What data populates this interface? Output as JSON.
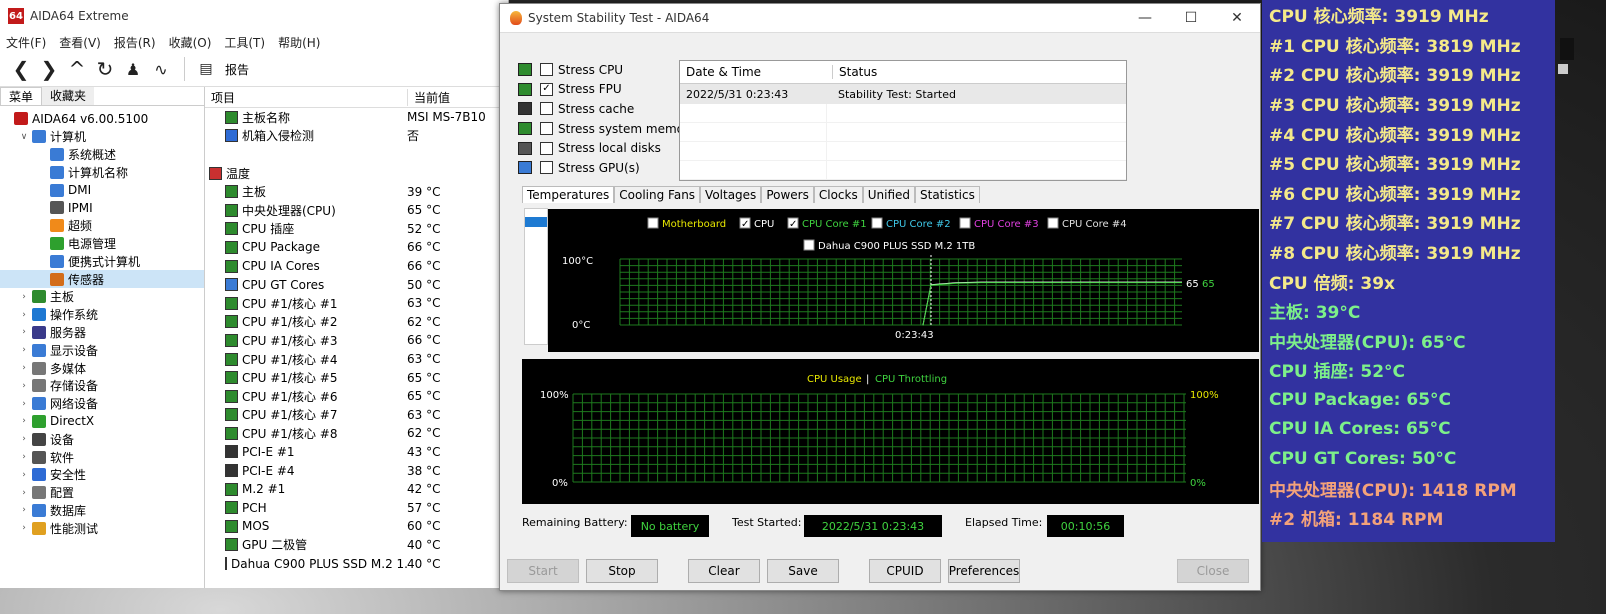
{
  "main_window": {
    "title": "AIDA64 Extreme",
    "logo": "64",
    "menu": [
      "文件(F)",
      "查看(V)",
      "报告(R)",
      "收藏(O)",
      "工具(T)",
      "帮助(H)"
    ],
    "toolbar_report": "报告",
    "tabs": {
      "menu": "菜单",
      "favorites": "收藏夹"
    },
    "tree": [
      {
        "label": "AIDA64 v6.00.5100",
        "level": 0,
        "icon": "aida-logo-icon",
        "color": "#c21a1a"
      },
      {
        "label": "计算机",
        "level": 1,
        "expanded": true,
        "icon": "computer-icon",
        "color": "#3a7bd5"
      },
      {
        "label": "系统概述",
        "level": 2,
        "icon": "summary-icon",
        "color": "#3a7bd5"
      },
      {
        "label": "计算机名称",
        "level": 2,
        "icon": "computer-name-icon",
        "color": "#3a7bd5"
      },
      {
        "label": "DMI",
        "level": 2,
        "icon": "dmi-icon",
        "color": "#3a7bd5"
      },
      {
        "label": "IPMI",
        "level": 2,
        "icon": "ipmi-icon",
        "color": "#555555"
      },
      {
        "label": "超频",
        "level": 2,
        "icon": "flame-icon",
        "color": "#f08a1a"
      },
      {
        "label": "电源管理",
        "level": 2,
        "icon": "power-icon",
        "color": "#2ea02e"
      },
      {
        "label": "便携式计算机",
        "level": 2,
        "icon": "laptop-icon",
        "color": "#3a7bd5"
      },
      {
        "label": "传感器",
        "level": 2,
        "icon": "sensor-icon",
        "color": "#d36d1a",
        "selected": true
      },
      {
        "label": "主板",
        "level": 1,
        "icon": "motherboard-icon",
        "color": "#2e8b2e"
      },
      {
        "label": "操作系统",
        "level": 1,
        "icon": "windows-icon",
        "color": "#1e78d2"
      },
      {
        "label": "服务器",
        "level": 1,
        "icon": "server-icon",
        "color": "#3a3a8a"
      },
      {
        "label": "显示设备",
        "level": 1,
        "icon": "display-icon",
        "color": "#3a7bd5"
      },
      {
        "label": "多媒体",
        "level": 1,
        "icon": "speaker-icon",
        "color": "#777777"
      },
      {
        "label": "存储设备",
        "level": 1,
        "icon": "storage-icon",
        "color": "#777777"
      },
      {
        "label": "网络设备",
        "level": 1,
        "icon": "network-icon",
        "color": "#3a7bd5"
      },
      {
        "label": "DirectX",
        "level": 1,
        "icon": "directx-icon",
        "color": "#2ea02e"
      },
      {
        "label": "设备",
        "level": 1,
        "icon": "device-icon",
        "color": "#444444"
      },
      {
        "label": "软件",
        "level": 1,
        "icon": "software-icon",
        "color": "#555555"
      },
      {
        "label": "安全性",
        "level": 1,
        "icon": "shield-icon",
        "color": "#2e6bd5"
      },
      {
        "label": "配置",
        "level": 1,
        "icon": "config-icon",
        "color": "#777777"
      },
      {
        "label": "数据库",
        "level": 1,
        "icon": "database-icon",
        "color": "#3a7bd5"
      },
      {
        "label": "性能测试",
        "level": 1,
        "icon": "benchmark-icon",
        "color": "#e0a020"
      }
    ],
    "columns": {
      "item": "项目",
      "value": "当前值"
    },
    "rows": [
      {
        "name": "主板名称",
        "value": "MSI MS-7B10",
        "icon": "motherboard-icon",
        "color": "#2e8b2e",
        "indent": 1
      },
      {
        "name": "机箱入侵检测",
        "value": "否",
        "icon": "shield-icon",
        "color": "#2e6bd5",
        "indent": 1
      },
      {
        "name": "",
        "value": "",
        "spacer": true
      },
      {
        "name": "温度",
        "value": "",
        "icon": "thermometer-icon",
        "color": "#c83030",
        "indent": 0
      },
      {
        "name": "主板",
        "value": "39 °C",
        "icon": "motherboard-icon",
        "color": "#2e8b2e",
        "indent": 1
      },
      {
        "name": "中央处理器(CPU)",
        "value": "65 °C",
        "icon": "cpu-icon",
        "color": "#2e8b2e",
        "indent": 1
      },
      {
        "name": "CPU 插座",
        "value": "52 °C",
        "icon": "cpu-icon",
        "color": "#2e8b2e",
        "indent": 1
      },
      {
        "name": "CPU Package",
        "value": "66 °C",
        "icon": "cpu-icon",
        "color": "#2e8b2e",
        "indent": 1
      },
      {
        "name": "CPU IA Cores",
        "value": "66 °C",
        "icon": "cpu-icon",
        "color": "#2e8b2e",
        "indent": 1
      },
      {
        "name": "CPU GT Cores",
        "value": "50 °C",
        "icon": "gpu-icon",
        "color": "#3a7bd5",
        "indent": 1
      },
      {
        "name": "CPU #1/核心 #1",
        "value": "63 °C",
        "icon": "cpu-icon",
        "color": "#2e8b2e",
        "indent": 1
      },
      {
        "name": "CPU #1/核心 #2",
        "value": "62 °C",
        "icon": "cpu-icon",
        "color": "#2e8b2e",
        "indent": 1
      },
      {
        "name": "CPU #1/核心 #3",
        "value": "66 °C",
        "icon": "cpu-icon",
        "color": "#2e8b2e",
        "indent": 1
      },
      {
        "name": "CPU #1/核心 #4",
        "value": "63 °C",
        "icon": "cpu-icon",
        "color": "#2e8b2e",
        "indent": 1
      },
      {
        "name": "CPU #1/核心 #5",
        "value": "65 °C",
        "icon": "cpu-icon",
        "color": "#2e8b2e",
        "indent": 1
      },
      {
        "name": "CPU #1/核心 #6",
        "value": "65 °C",
        "icon": "cpu-icon",
        "color": "#2e8b2e",
        "indent": 1
      },
      {
        "name": "CPU #1/核心 #7",
        "value": "63 °C",
        "icon": "cpu-icon",
        "color": "#2e8b2e",
        "indent": 1
      },
      {
        "name": "CPU #1/核心 #8",
        "value": "62 °C",
        "icon": "cpu-icon",
        "color": "#2e8b2e",
        "indent": 1
      },
      {
        "name": "PCI-E #1",
        "value": "43 °C",
        "icon": "pcie-icon",
        "color": "#333333",
        "indent": 1
      },
      {
        "name": "PCI-E #4",
        "value": "38 °C",
        "icon": "pcie-icon",
        "color": "#333333",
        "indent": 1
      },
      {
        "name": "M.2 #1",
        "value": "42 °C",
        "icon": "m2-icon",
        "color": "#2e8b2e",
        "indent": 1
      },
      {
        "name": "PCH",
        "value": "57 °C",
        "icon": "chip-icon",
        "color": "#2e8b2e",
        "indent": 1
      },
      {
        "name": "MOS",
        "value": "60 °C",
        "icon": "mos-icon",
        "color": "#2e8b2e",
        "indent": 1
      },
      {
        "name": "GPU 二极管",
        "value": "40 °C",
        "icon": "gpu-icon",
        "color": "#2e8b2e",
        "indent": 1
      },
      {
        "name": "Dahua C900 PLUS SSD M.2 1...",
        "value": "40 °C",
        "icon": "ssd-icon",
        "color": "#555555",
        "indent": 1
      }
    ]
  },
  "stability_window": {
    "title": "System Stability Test - AIDA64",
    "stress_options": [
      {
        "label": "Stress CPU",
        "checked": false,
        "icon": "cpu-icon"
      },
      {
        "label": "Stress FPU",
        "checked": true,
        "icon": "fpu-icon"
      },
      {
        "label": "Stress cache",
        "checked": false,
        "icon": "cache-icon"
      },
      {
        "label": "Stress system memory",
        "checked": false,
        "icon": "memory-icon"
      },
      {
        "label": "Stress local disks",
        "checked": false,
        "icon": "disk-icon"
      },
      {
        "label": "Stress GPU(s)",
        "checked": false,
        "icon": "gpu-icon"
      }
    ],
    "log_columns": {
      "date": "Date & Time",
      "status": "Status"
    },
    "log_rows": [
      {
        "date": "2022/5/31 0:23:43",
        "status": "Stability Test: Started"
      }
    ],
    "tabs": [
      "Temperatures",
      "Cooling Fans",
      "Voltages",
      "Powers",
      "Clocks",
      "Unified",
      "Statistics"
    ],
    "active_tab": "Temperatures",
    "temp_legend": [
      {
        "label": "Motherboard",
        "checked": false,
        "color": "#e8e800"
      },
      {
        "label": "CPU",
        "checked": true,
        "color": "#ffffff"
      },
      {
        "label": "CPU Core #1",
        "checked": true,
        "color": "#3fd33f"
      },
      {
        "label": "CPU Core #2",
        "checked": false,
        "color": "#3fc8e8"
      },
      {
        "label": "CPU Core #3",
        "checked": false,
        "color": "#e040e0"
      },
      {
        "label": "CPU Core #4",
        "checked": false,
        "color": "#e0e0e0"
      }
    ],
    "temp_legend_2": {
      "label": "Dahua C900 PLUS SSD M.2 1TB",
      "checked": false,
      "color": "#ffffff"
    },
    "temp_axis": {
      "top": "100°C",
      "bottom": "0°C",
      "time": "0:23:43",
      "value_white": "65",
      "value_green": "65"
    },
    "usage_legend": {
      "usage": "CPU Usage",
      "sep": "|",
      "throttling": "CPU Throttling",
      "usage_color": "#e8e800",
      "throttling_color": "#3fd33f"
    },
    "usage_axis": {
      "top_left": "100%",
      "bottom_left": "0%",
      "top_right": "100%",
      "bottom_right": "0%"
    },
    "remaining_battery_label": "Remaining Battery:",
    "remaining_battery_value": "No battery",
    "test_started_label": "Test Started:",
    "test_started_value": "2022/5/31 0:23:43",
    "elapsed_label": "Elapsed Time:",
    "elapsed_value": "00:10:56",
    "buttons": {
      "start": "Start",
      "stop": "Stop",
      "clear": "Clear",
      "save": "Save",
      "cpuid": "CPUID",
      "preferences": "Preferences",
      "close": "Close"
    },
    "chart_data": {
      "type": "line",
      "series": [
        {
          "x": [
            "0:23:43",
            "end"
          ],
          "values": [
            0,
            61,
            64,
            65,
            65,
            65,
            65,
            65,
            65,
            65,
            65,
            65
          ]
        }
      ],
      "ylim": [
        0,
        100
      ]
    }
  },
  "osd": {
    "lines": [
      {
        "text": "CPU 核心频率: 3919 MHz",
        "color": "#f4e98a"
      },
      {
        "text": "#1 CPU 核心频率: 3819 MHz",
        "color": "#f4e98a"
      },
      {
        "text": "#2 CPU 核心频率: 3919 MHz",
        "color": "#f4e98a"
      },
      {
        "text": "#3 CPU 核心频率: 3919 MHz",
        "color": "#f4e98a"
      },
      {
        "text": "#4 CPU 核心频率: 3919 MHz",
        "color": "#f4e98a"
      },
      {
        "text": "#5 CPU 核心频率: 3919 MHz",
        "color": "#f4e98a"
      },
      {
        "text": "#6 CPU 核心频率: 3919 MHz",
        "color": "#f4e98a"
      },
      {
        "text": "#7 CPU 核心频率: 3919 MHz",
        "color": "#f4e98a"
      },
      {
        "text": "#8 CPU 核心频率: 3919 MHz",
        "color": "#f4e98a"
      },
      {
        "text": "CPU 倍频: 39x",
        "color": "#f4e98a"
      },
      {
        "text": "主板: 39°C",
        "color": "#7df08a"
      },
      {
        "text": "中央处理器(CPU): 65°C",
        "color": "#7df08a"
      },
      {
        "text": "CPU 插座: 52°C",
        "color": "#7df08a"
      },
      {
        "text": "CPU Package: 65°C",
        "color": "#7df08a"
      },
      {
        "text": "CPU IA Cores: 65°C",
        "color": "#7df08a"
      },
      {
        "text": "CPU GT Cores: 50°C",
        "color": "#7df08a"
      },
      {
        "text": "中央处理器(CPU): 1418 RPM",
        "color": "#f4a27a"
      },
      {
        "text": "#2 机箱: 1184 RPM",
        "color": "#f4a27a"
      }
    ]
  }
}
